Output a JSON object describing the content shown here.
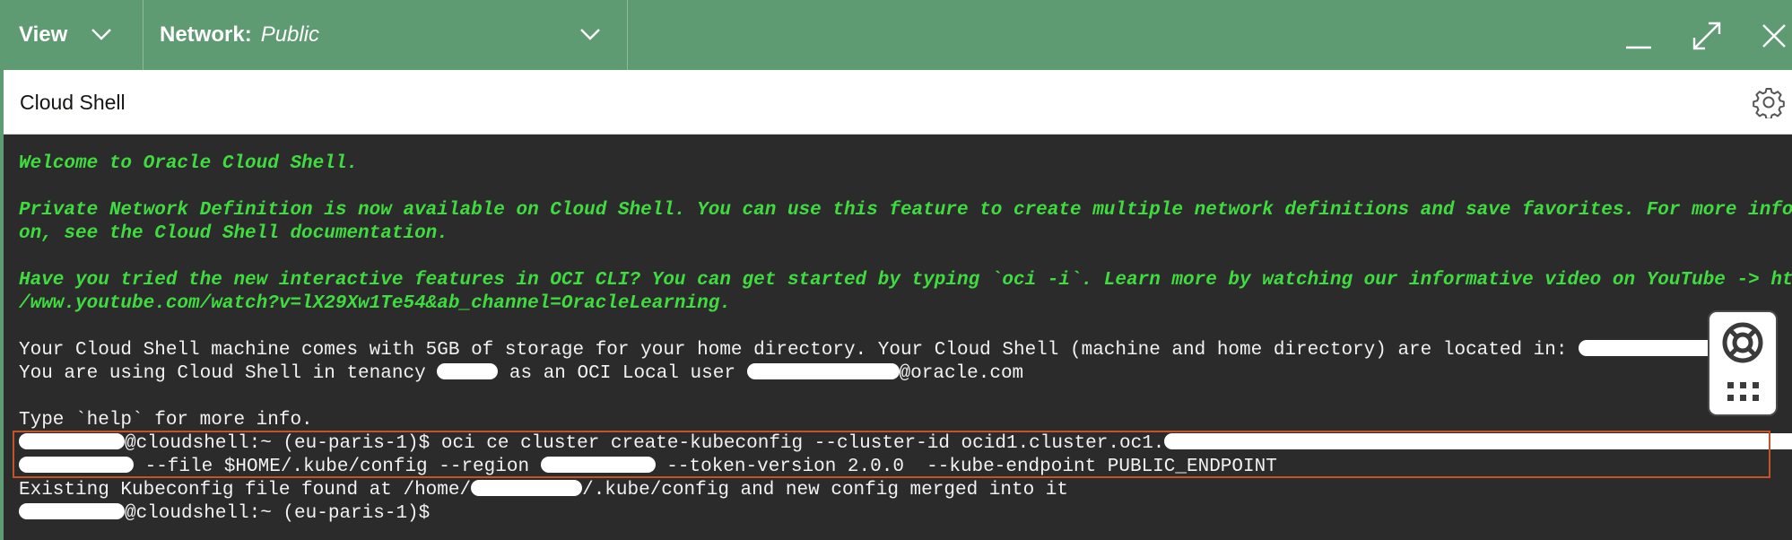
{
  "header": {
    "view_label": "View",
    "network_label": "Network:",
    "network_value": "Public"
  },
  "panel": {
    "title": "Cloud Shell"
  },
  "terminal": {
    "welcome": "Welcome to Oracle Cloud Shell.",
    "private_net_1": "Private Network Definition is now available on Cloud Shell. You can use this feature to create multiple network definitions and save favorites. For more informati",
    "private_net_2": "on, see the Cloud Shell documentation.",
    "oci_cli_1": "Have you tried the new interactive features in OCI CLI? You can get started by typing `oci -i`. Learn more by watching our informative video on YouTube -> https:/",
    "oci_cli_2": "/www.youtube.com/watch?v=lX29Xw1Te54&ab_channel=OracleLearning.",
    "storage_line_prefix": "Your Cloud Shell machine comes with 5GB of storage for your home directory. Your Cloud Shell (machine and home directory) are located in: ",
    "storage_line_suffix": ".",
    "tenancy_prefix": "You are using Cloud Shell in tenancy ",
    "tenancy_mid": " as an OCI Local user ",
    "tenancy_suffix": "@oracle.com",
    "help_line": "Type `help` for more info.",
    "prompt_host": "@cloudshell:~ (eu-paris-1)$",
    "command_1": " oci ce cluster create-kubeconfig --cluster-id ocid1.cluster.oc1.",
    "command_2": " --file $HOME/.kube/config --region ",
    "command_3": " --token-version 2.0.0  --kube-endpoint PUBLIC_ENDPOINT",
    "result_prefix": "Existing Kubeconfig file found at /home/",
    "result_suffix": "/.kube/config and new config merged into it",
    "final_prompt": "@cloudshell:~ (eu-paris-1)$"
  },
  "icons": {
    "view_chevron": "chevron-down-icon",
    "network_chevron": "chevron-down-icon",
    "minimize": "minimize-icon",
    "maximize": "maximize-icon",
    "close": "close-icon",
    "settings": "gear-icon",
    "help": "lifebuoy-icon",
    "apps": "grid-icon"
  },
  "colors": {
    "header_bg": "#5e9a72",
    "terminal_bg": "#2b2b2b",
    "terminal_green": "#3fdc3f",
    "highlight_border": "#c4532a"
  }
}
